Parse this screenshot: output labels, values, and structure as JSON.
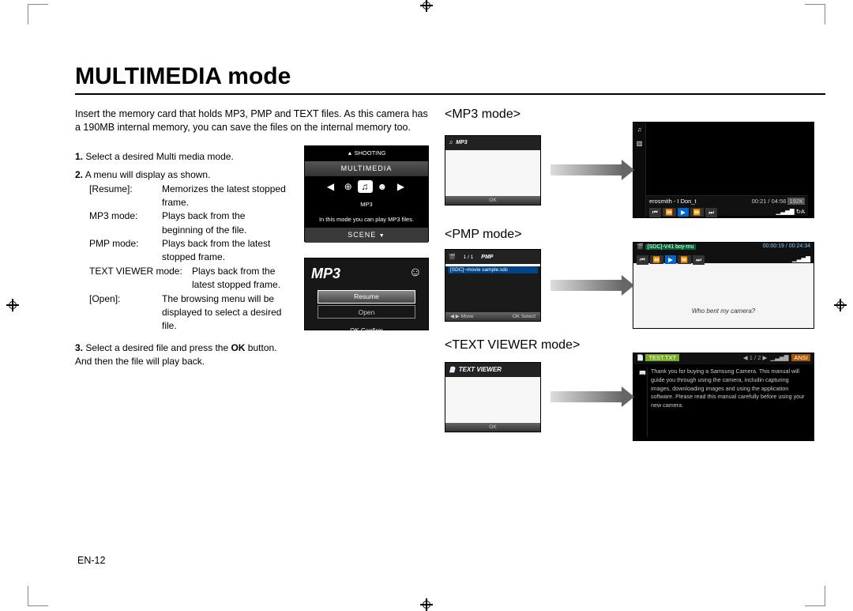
{
  "page": {
    "title": "MULTIMEDIA mode",
    "intro": "Insert the memory card that holds MP3, PMP and TEXT files. As this camera has a 190MB internal memory, you can save the files on the internal memory too.",
    "page_number": "EN-12"
  },
  "steps": {
    "s1": "Select a desired Multi media mode.",
    "s2": "A menu will display as shown.",
    "defs": {
      "resume_k": "[Resume]:",
      "resume_v": "Memorizes the latest stopped frame.",
      "mp3_k": "MP3 mode:",
      "mp3_v": "Plays back from the beginning of the file.",
      "pmp_k": "PMP mode:",
      "pmp_v": "Plays back from the latest stopped frame.",
      "txt_k": "TEXT VIEWER mode:",
      "txt_v": "Plays back from the latest stopped frame.",
      "open_k": "[Open]:",
      "open_v": "The browsing menu will be displayed to select a desired file."
    },
    "s3a": "Select a desired file and press the ",
    "s3_ok": "OK",
    "s3b": " button. And then the file will play back."
  },
  "menuScreen": {
    "up": "SHOOTING",
    "band": "MULTIMEDIA",
    "label": "MP3",
    "desc": "In this mode you can play MP3 files.",
    "down": "SCENE"
  },
  "mp3res": {
    "logo": "MP3",
    "opt1": "Resume",
    "opt2": "Open",
    "confirm": "OK  Confirm"
  },
  "modes": {
    "mp3": "<MP3 mode>",
    "pmp": "<PMP mode>",
    "txt": "<TEXT VIEWER mode>"
  },
  "mp3L": {
    "hdr": "MP3",
    "ok": "OK"
  },
  "mp3R": {
    "track": "erosmith - I Don_t",
    "time": "00:21 / 04:56",
    "bitrate": "192K"
  },
  "pmpL": {
    "count": "1 / 1",
    "label": "PMP",
    "file": "[SDC]~movie sample.sdc",
    "move": "◀ ▶  Move",
    "select": "OK  Select"
  },
  "pmpR": {
    "file": "[SDC]-V41 boy-mu",
    "time": "00:00:19 / 00:24:34",
    "caption": "Who bent my camera?"
  },
  "txtL": {
    "hdr": "TEXT VIEWER",
    "ok": "OK"
  },
  "txtR": {
    "file": "TEST.TXT",
    "page": "1 / 2",
    "ansi": "ANSI",
    "body": "Thank you for buying a Samsung Camera. This manual will guide you through using the camera, includin capturing images, downloading images and using the application software. Please read this manual carefully before using your new camera."
  }
}
